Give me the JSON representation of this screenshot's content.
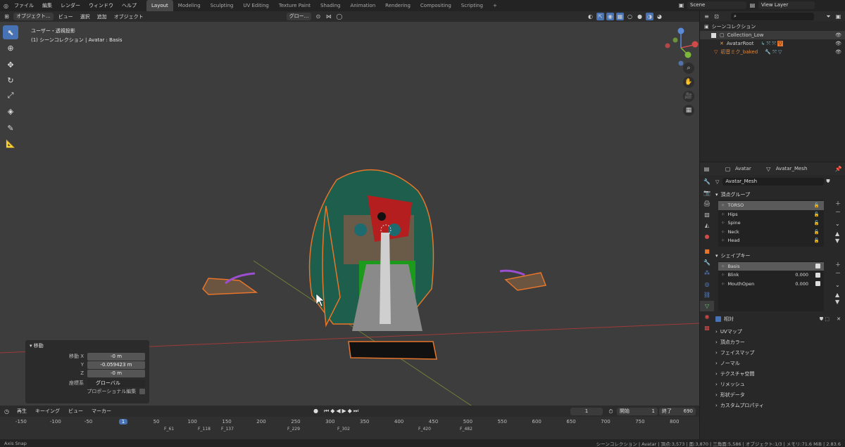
{
  "menu": {
    "items": [
      "ファイル",
      "編集",
      "レンダー",
      "ウィンドウ",
      "ヘルプ"
    ]
  },
  "workspaces": [
    "Layout",
    "Modeling",
    "Sculpting",
    "UV Editing",
    "Texture Paint",
    "Shading",
    "Animation",
    "Rendering",
    "Compositing",
    "Scripting"
  ],
  "active_workspace": "Layout",
  "scene_name": "Scene",
  "view_layer": "View Layer",
  "viewport_header": {
    "mode": "オブジェクト...",
    "view": "ビュー",
    "select": "選択",
    "add": "追加",
    "object": "オブジェクト",
    "orientation": "グロー..."
  },
  "viewport_info": {
    "line1": "ユーザー・透視投影",
    "line2": "(1) シーンコレクション | Avatar : Basis"
  },
  "operator_panel": {
    "title": "移動",
    "move_x_label": "移動 X",
    "move_x": "-0 m",
    "y_label": "Y",
    "y": "-0.059423 m",
    "z_label": "Z",
    "z": "-0 m",
    "orient_label": "座標系",
    "orient": "グローバル",
    "proportional_label": "プロポーショナル編集"
  },
  "timeline_header": {
    "playback": "再生",
    "keying": "キーイング",
    "view": "ビュー",
    "marker": "マーカー",
    "current_frame": "1",
    "start_label": "開始",
    "start": "1",
    "end_label": "終了",
    "end": "690"
  },
  "timeline_ticks": [
    "-150",
    "-100",
    "-50",
    "1",
    "50",
    "100",
    "150",
    "200",
    "250",
    "300",
    "350",
    "400",
    "450",
    "500",
    "550",
    "600",
    "650",
    "700",
    "750",
    "800"
  ],
  "timeline_markers": [
    "F_61",
    "F_118",
    "F_137",
    "F_229",
    "F_302",
    "F_420",
    "F_482"
  ],
  "status": {
    "left": "Axis Snap",
    "right": "シーンコレクション | Avatar | 頂点:3,573 | 面:3,870 | 三角面:5,586 | オブジェクト:1/3 | メモリ:71.6 MiB | 2.83.6"
  },
  "outliner": {
    "root": "シーンコレクション",
    "items": [
      {
        "label": "Collection_Low",
        "color": "#d0d0d0"
      },
      {
        "label": "AvatarRoot",
        "color": "#d0d0d0"
      },
      {
        "label": "初音ミク_baked",
        "color": "#e08a3c"
      }
    ]
  },
  "properties": {
    "object": "Avatar",
    "data": "Avatar_Mesh",
    "mesh_name": "Avatar_Mesh",
    "vertex_groups": {
      "title": "頂点グループ",
      "items": [
        "TORSO",
        "Hips",
        "Spine",
        "Neck",
        "Head"
      ]
    },
    "shape_keys": {
      "title": "シェイプキー",
      "items": [
        {
          "name": "Basis",
          "value": ""
        },
        {
          "name": "Blink",
          "value": "0.000"
        },
        {
          "name": "MouthOpen",
          "value": "0.000"
        }
      ],
      "relative_label": "相対"
    },
    "sections": [
      "UVマップ",
      "頂点カラー",
      "フェイスマップ",
      "ノーマル",
      "テクスチャ空間",
      "リメッシュ",
      "形状データ",
      "カスタムプロパティ"
    ]
  },
  "colors": {
    "accent": "#4772b3",
    "selected_orange": "#e8752a"
  }
}
